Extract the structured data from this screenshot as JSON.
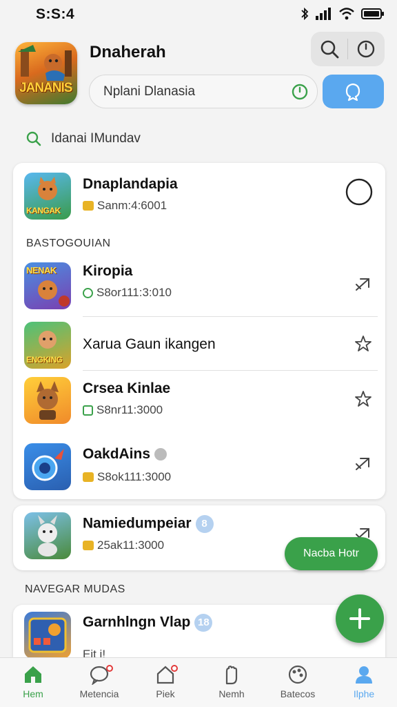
{
  "status_bar": {
    "time": "S:S:4"
  },
  "header": {
    "app_icon_text": "JANANIS",
    "title": "Dnaherah",
    "search_value": "Nplani Dlanasia"
  },
  "filter": {
    "label": "Idanai IMundav"
  },
  "featured": {
    "name": "Dnaplandapia",
    "sub": "Sanm:4:6001",
    "thumb_text": "KANGAK"
  },
  "section1": {
    "title": "BASTOGOUIAN"
  },
  "items": [
    {
      "name": "Kiropia",
      "sub": "S8or111:3:010",
      "thumb_text": "NENAK",
      "badge": "green-circle",
      "action": "send-icon"
    },
    {
      "name": "Xarua Gaun ikangen",
      "sub": "",
      "thumb_text": "ENGKING",
      "badge": "",
      "action": "star-icon"
    },
    {
      "name": "Crsea Kinlae",
      "sub": "S8nr11:3000",
      "thumb_text": "",
      "badge": "green-square",
      "action": "star-icon"
    },
    {
      "name": "OakdAins",
      "sub": "S8ok111:3000",
      "thumb_text": "",
      "badge": "yellow",
      "action": "send-icon"
    }
  ],
  "card2": {
    "name": "Namiedumpeiar",
    "pill": "8",
    "sub": "25ak11:3000"
  },
  "section2": {
    "title": "NAVEGAR MUDAS"
  },
  "card3": {
    "name": "Garnhlngn Vlap",
    "pill": "18",
    "sub": "Eit i!"
  },
  "fab_pill_label": "Nacba Hotr",
  "nav": [
    {
      "label": "Hem",
      "icon": "home-icon"
    },
    {
      "label": "Metencia",
      "icon": "chat-icon"
    },
    {
      "label": "Piek",
      "icon": "house-notify-icon"
    },
    {
      "label": "Nemh",
      "icon": "hand-icon"
    },
    {
      "label": "Batecos",
      "icon": "palette-icon"
    },
    {
      "label": "Ilphe",
      "icon": "profile-icon"
    }
  ],
  "colors": {
    "accent": "#3aa14a",
    "blue": "#5aa8ef",
    "background": "#f3f3f3"
  }
}
